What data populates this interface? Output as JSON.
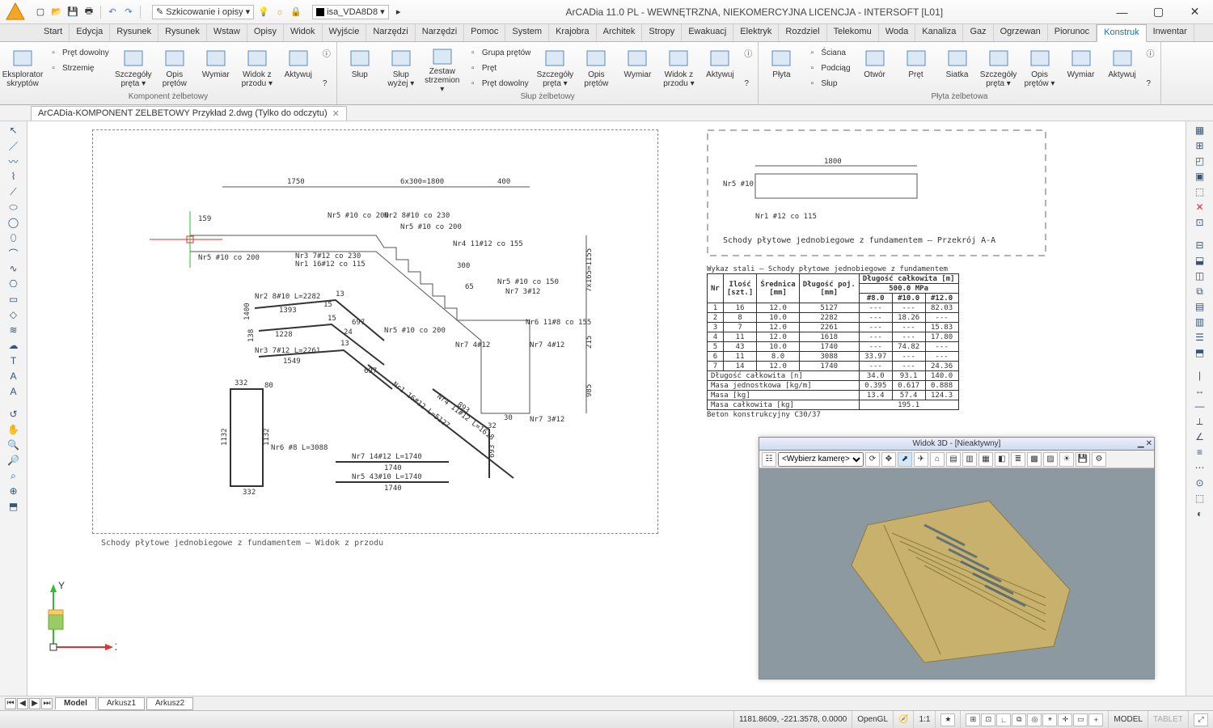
{
  "window": {
    "title": "ArCADia 11.0 PL - WEWNĘTRZNA, NIEKOMERCYJNA LICENCJA - INTERSOFT [L01]"
  },
  "qat": {
    "style_combo": "Szkicowanie i opisy",
    "layer_combo": "isa_VDA8D8"
  },
  "ribbon_tabs": [
    "Start",
    "Edycja",
    "Rysunek",
    "Rysunek",
    "Wstaw",
    "Opisy",
    "Widok",
    "Wyjście",
    "Narzędzia",
    "Narzędzia",
    "Pomoc",
    "System",
    "Krajobraz",
    "Architekt",
    "Stropy",
    "Ewakuacja",
    "Elektryka",
    "Rozdzielnice",
    "Telekomunikacja",
    "Woda",
    "Kanalizacja",
    "Gaz",
    "Ogrzewanie",
    "Piorunochron",
    "Konstrukcje",
    "Inwentaryzacja"
  ],
  "ribbon_active_index": 24,
  "ribbon_groups": {
    "g1": {
      "label": "Komponent żelbetowy",
      "big": [
        {
          "label": "Eksplorator\nskryptów"
        },
        {
          "label": "Szczegóły\npręta ▾"
        },
        {
          "label": "Opis\nprętów"
        },
        {
          "label": "Wymiar"
        },
        {
          "label": "Widok z\nprzodu ▾"
        },
        {
          "label": "Aktywuj"
        }
      ],
      "small": [
        {
          "label": "Pręt dowolny"
        },
        {
          "label": "Strzemię"
        }
      ]
    },
    "g2": {
      "label": "Słup żelbetowy",
      "big": [
        {
          "label": "Słup"
        },
        {
          "label": "Słup\nwyżej ▾"
        },
        {
          "label": "Zestaw\nstrzemion ▾"
        },
        {
          "label": "Szczegóły\npręta ▾"
        },
        {
          "label": "Opis\nprętów"
        },
        {
          "label": "Wymiar"
        },
        {
          "label": "Widok z\nprzodu ▾"
        },
        {
          "label": "Aktywuj"
        }
      ],
      "small": [
        {
          "label": "Grupa prętów"
        },
        {
          "label": "Pręt"
        },
        {
          "label": "Pręt dowolny"
        }
      ]
    },
    "g3": {
      "label": "Płyta żelbetowa",
      "big": [
        {
          "label": "Płyta"
        },
        {
          "label": "Otwór"
        },
        {
          "label": "Pręt"
        },
        {
          "label": "Siatka"
        },
        {
          "label": "Szczegóły\npręta ▾"
        },
        {
          "label": "Opis\nprętów ▾"
        },
        {
          "label": "Wymiar"
        },
        {
          "label": "Aktywuj"
        }
      ],
      "small": [
        {
          "label": "Ściana"
        },
        {
          "label": "Podciąg"
        },
        {
          "label": "Słup"
        }
      ]
    }
  },
  "doc_tab": "ArCADia-KOMPONENT ZELBETOWY Przykład 2.dwg (Tylko do odczytu)",
  "drawing": {
    "caption_left": "Schody płytowe jednobiegowe z fundamentem – Widok z przodu",
    "caption_right": "Schody płytowe jednobiegowe z fundamentem – Przekrój A-A",
    "dim1": "1750",
    "dim2": "6x300=1800",
    "dim3": "400",
    "dim4": "7x165=1155",
    "dim5": "215",
    "dim6": "985",
    "dim7": "1800",
    "dim8": "300",
    "labels": [
      "Nr5 #10 co 200",
      "Nr2 8#10 co 230",
      "Nr5 #10 co 200",
      "Nr3 7#12 co 230",
      "Nr1 16#12 co 115",
      "Nr4 11#12 co 155",
      "Nr5 #10 co 150",
      "Nr7 3#12",
      "Nr5 #10 co 200",
      "Nr7 4#12",
      "Nr6 11#8 co 155",
      "Nr7 4#12",
      "Nr7 3#12",
      "Nr5 #10",
      "Nr1 #12 co 115"
    ],
    "bars": [
      {
        "t": "Nr2 8#10 L=2282",
        "sub": "1393",
        "a": "697",
        "b": "15",
        "c": "13",
        "d": "1400"
      },
      {
        "t": "",
        "sub": "1228",
        "a": "",
        "b": "24",
        "c": "15",
        "d": "138"
      },
      {
        "t": "Nr3 7#12 L=2261",
        "sub": "1549",
        "a": "697",
        "b": "",
        "c": "13",
        "d": ""
      },
      {
        "t": "Nr1 16#12 L=5127",
        "sub": "",
        "a": "",
        "b": "",
        "c": "",
        "d": ""
      },
      {
        "t": "Nr4 11#12 L=1618",
        "sub": "893",
        "a": "",
        "b": "32",
        "c": "",
        "d": ""
      },
      {
        "t": "Nr6 #8 L=3088",
        "sub": "",
        "a": "332",
        "b": "80",
        "c": "",
        "d": ""
      },
      {
        "t": "Nr7 14#12 L=1740",
        "sub": "1740",
        "a": "",
        "b": "",
        "c": "",
        "d": ""
      },
      {
        "t": "Nr5 43#10 L=1740",
        "sub": "1740",
        "a": "",
        "b": "",
        "c": "",
        "d": ""
      }
    ],
    "extras": {
      "n1132a": "1132",
      "n1132b": "1132",
      "n332": "332",
      "n693": "693",
      "n30": "30",
      "n159": "159",
      "n65": "65"
    }
  },
  "steel_table": {
    "title": "Wykaz stali – Schody płytowe jednobiegowe z fundamentem",
    "headers": {
      "nr": "Nr",
      "ilosc": "Ilość\n[szt.]",
      "srednica": "Średnica\n[mm]",
      "dlugosc_poj": "Długość poj.\n[mm]",
      "dlugosc_calk": "Długość całkowita [m]",
      "klasa": "500.0 MPa",
      "c1": "#8.0",
      "c2": "#10.0",
      "c3": "#12.0"
    },
    "rows": [
      {
        "nr": "1",
        "il": "16",
        "sr": "12.0",
        "dp": "5127",
        "c1": "---",
        "c2": "---",
        "c3": "82.03"
      },
      {
        "nr": "2",
        "il": "8",
        "sr": "10.0",
        "dp": "2282",
        "c1": "---",
        "c2": "18.26",
        "c3": "---"
      },
      {
        "nr": "3",
        "il": "7",
        "sr": "12.0",
        "dp": "2261",
        "c1": "---",
        "c2": "---",
        "c3": "15.83"
      },
      {
        "nr": "4",
        "il": "11",
        "sr": "12.0",
        "dp": "1618",
        "c1": "---",
        "c2": "---",
        "c3": "17.80"
      },
      {
        "nr": "5",
        "il": "43",
        "sr": "10.0",
        "dp": "1740",
        "c1": "---",
        "c2": "74.82",
        "c3": "---"
      },
      {
        "nr": "6",
        "il": "11",
        "sr": "8.0",
        "dp": "3088",
        "c1": "33.97",
        "c2": "---",
        "c3": "---"
      },
      {
        "nr": "7",
        "il": "14",
        "sr": "12.0",
        "dp": "1740",
        "c1": "---",
        "c2": "---",
        "c3": "24.36"
      }
    ],
    "summary": [
      {
        "label": "Długość całkowita [n]",
        "c1": "34.0",
        "c2": "93.1",
        "c3": "140.0"
      },
      {
        "label": "Masa jednostkowa [kg/m]",
        "c1": "0.395",
        "c2": "0.617",
        "c3": "0.888"
      },
      {
        "label": "Masa [kg]",
        "c1": "13.4",
        "c2": "57.4",
        "c3": "124.3"
      },
      {
        "label": "Masa całkowita [kg]",
        "c": "195.1"
      }
    ],
    "footer": "Beton konstrukcyjny C30/37"
  },
  "view3d": {
    "title": "Widok 3D - [Nieaktywny]",
    "camera_placeholder": "<Wybierz kamerę>"
  },
  "sheet_tabs": [
    "Model",
    "Arkusz1",
    "Arkusz2"
  ],
  "sheet_active": 0,
  "ucs": {
    "y": "Y",
    "x": "X"
  },
  "status": {
    "coords": "1181.8609, -221.3578, 0.0000",
    "render": "OpenGL",
    "scale": "1:1",
    "model": "MODEL",
    "tablet": "TABLET"
  }
}
